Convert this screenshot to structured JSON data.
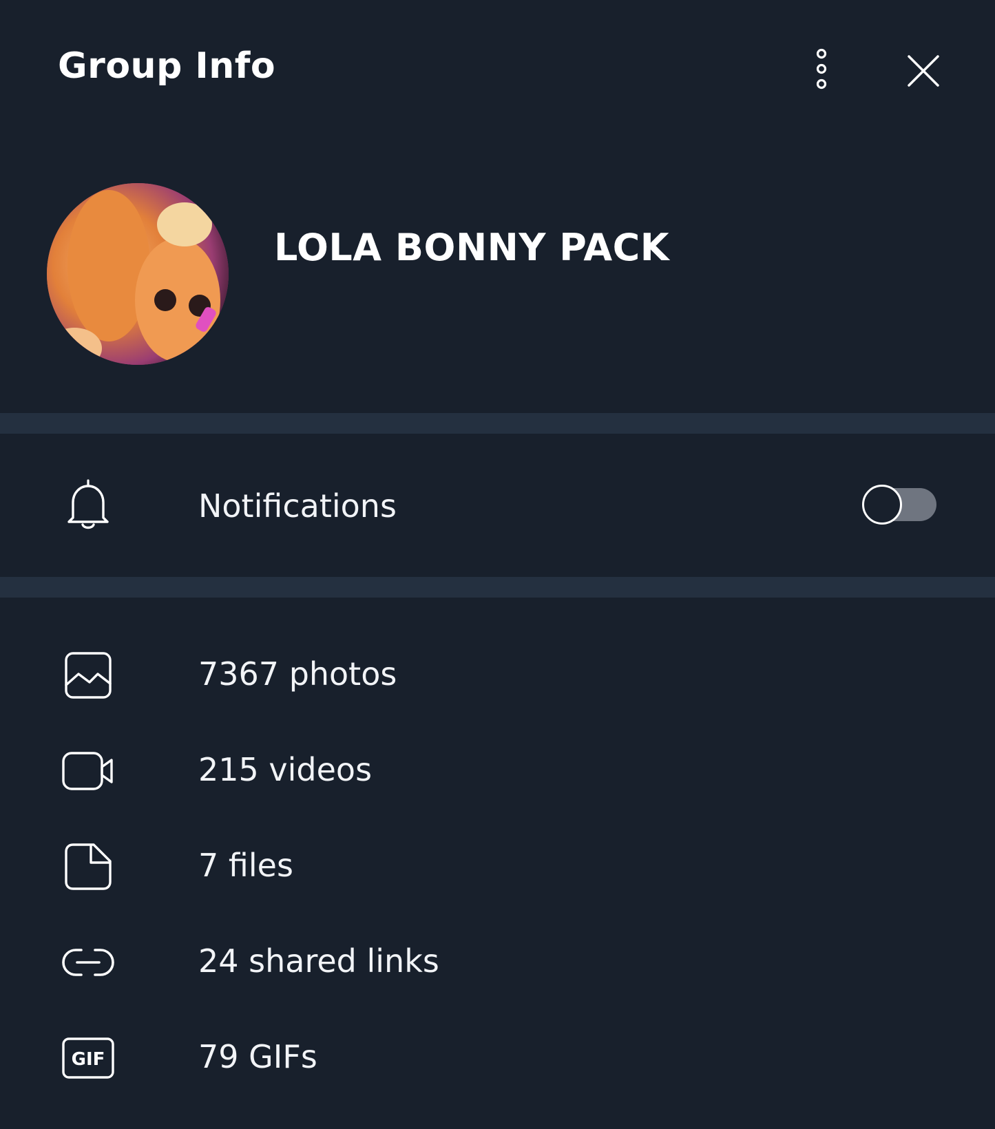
{
  "header": {
    "title": "Group Info"
  },
  "profile": {
    "name": "LOLA BONNY PACK"
  },
  "notifications": {
    "label": "Notifications",
    "enabled": false
  },
  "media": [
    {
      "label": "7367 photos",
      "icon": "photo-icon"
    },
    {
      "label": "215 videos",
      "icon": "video-icon"
    },
    {
      "label": "7 files",
      "icon": "file-icon"
    },
    {
      "label": "24 shared links",
      "icon": "link-icon"
    },
    {
      "label": "79 GIFs",
      "icon": "gif-icon"
    }
  ],
  "colors": {
    "background": "#18202c",
    "divider": "#243040",
    "text": "#ffffff",
    "toggle_track": "#6f7580"
  }
}
